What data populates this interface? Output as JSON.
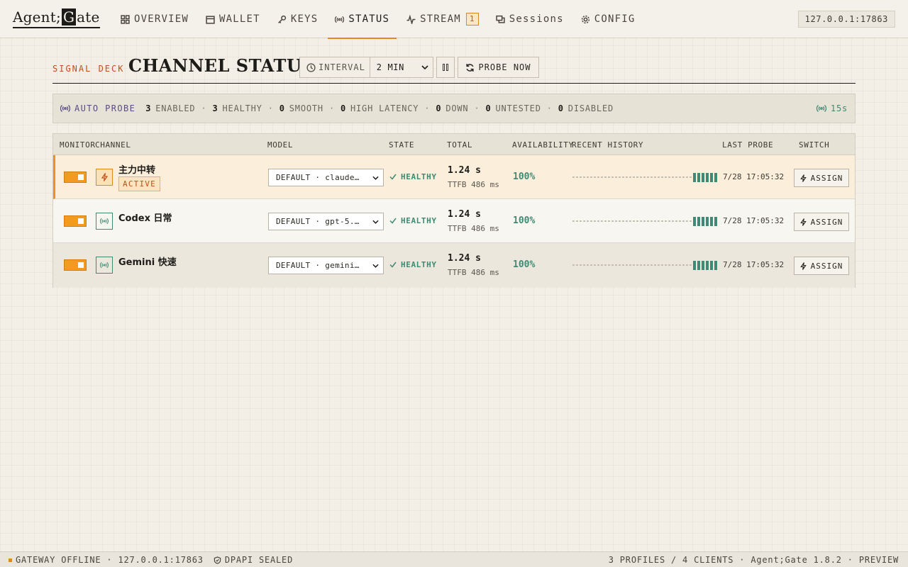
{
  "app": {
    "logo_left": "Agent;",
    "logo_g": "G",
    "logo_right": "ate",
    "address": "127.0.0.1:17863"
  },
  "nav": {
    "items": [
      {
        "label": "OVERVIEW",
        "icon": "grid-icon"
      },
      {
        "label": "WALLET",
        "icon": "wallet-icon"
      },
      {
        "label": "KEYS",
        "icon": "key-icon"
      },
      {
        "label": "STATUS",
        "icon": "signal-icon",
        "active": true
      },
      {
        "label": "STREAM",
        "icon": "pulse-icon",
        "badge": "1"
      },
      {
        "label": "Sessions",
        "icon": "chat-icon"
      },
      {
        "label": "CONFIG",
        "icon": "gear-icon"
      }
    ]
  },
  "heading": {
    "kicker": "SIGNAL DECK",
    "title": "CHANNEL STATUS",
    "interval_label": "INTERVAL",
    "interval_value": "2 MIN",
    "probe_button": "PROBE NOW"
  },
  "summary": {
    "auto_probe": "AUTO PROBE",
    "enabled_count": "3",
    "enabled_label": "ENABLED",
    "healthy_count": "3",
    "healthy_label": "HEALTHY",
    "smooth_count": "0",
    "smooth_label": "SMOOTH",
    "high_latency_count": "0",
    "high_latency_label": "HIGH LATENCY",
    "down_count": "0",
    "down_label": "DOWN",
    "untested_count": "0",
    "untested_label": "UNTESTED",
    "disabled_count": "0",
    "disabled_label": "DISABLED",
    "timer": "15s"
  },
  "table": {
    "headers": [
      "MONITOR",
      "CHANNEL",
      "MODEL",
      "STATE",
      "TOTAL",
      "AVAILABILITY",
      "RECENT HISTORY",
      "LAST PROBE",
      "SWITCH"
    ],
    "rows": [
      {
        "name": "主力中转",
        "badge": "ACTIVE",
        "model": "DEFAULT · claude…",
        "state": "HEALTHY",
        "total": "1.24 s",
        "ttfb": "TTFB 486 ms",
        "availability": "100%",
        "history_bars": 6,
        "last_probe": "7/28 17:05:32",
        "switch": "ASSIGN",
        "monitor_on": true
      },
      {
        "name": "Codex 日常",
        "model": "DEFAULT · gpt-5.…",
        "state": "HEALTHY",
        "total": "1.24 s",
        "ttfb": "TTFB 486 ms",
        "availability": "100%",
        "history_bars": 6,
        "last_probe": "7/28 17:05:32",
        "switch": "ASSIGN",
        "monitor_on": true
      },
      {
        "name": "Gemini 快速",
        "model": "DEFAULT · gemini…",
        "state": "HEALTHY",
        "total": "1.24 s",
        "ttfb": "TTFB 486 ms",
        "availability": "100%",
        "history_bars": 6,
        "last_probe": "7/28 17:05:32",
        "switch": "ASSIGN",
        "monitor_on": true
      }
    ]
  },
  "statusbar": {
    "gateway": "GATEWAY OFFLINE · 127.0.0.1:17863",
    "dpapi": "DPAPI SEALED",
    "right": "3 PROFILES / 4 CLIENTS · Agent;Gate 1.8.2 · PREVIEW"
  },
  "colors": {
    "accent_orange": "#f39a20",
    "healthy_green": "#3f8a74",
    "auto_probe_purple": "#5b4b86",
    "kicker_red": "#c2501a"
  }
}
